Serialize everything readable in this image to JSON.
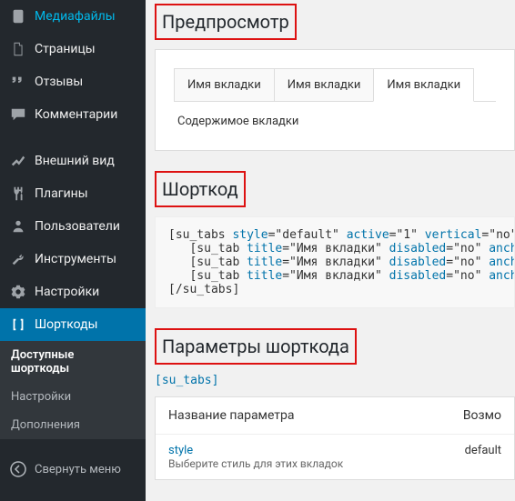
{
  "sidebar": {
    "items": [
      {
        "label": "Медиафайлы"
      },
      {
        "label": "Страницы"
      },
      {
        "label": "Отзывы"
      },
      {
        "label": "Комментарии"
      },
      {
        "label": "Внешний вид"
      },
      {
        "label": "Плагины"
      },
      {
        "label": "Пользователи"
      },
      {
        "label": "Инструменты"
      },
      {
        "label": "Настройки"
      },
      {
        "label": "Шорткоды"
      }
    ],
    "sub": [
      {
        "label": "Доступные шорткоды"
      },
      {
        "label": "Настройки"
      },
      {
        "label": "Дополнения"
      }
    ],
    "collapse": "Свернуть меню"
  },
  "sections": {
    "preview": "Предпросмотр",
    "shortcode": "Шорткод",
    "params": "Параметры шорткода"
  },
  "preview": {
    "tabs": [
      "Имя вкладки",
      "Имя вкладки",
      "Имя вкладки"
    ],
    "content": "Содержимое вкладки"
  },
  "shortcode_text": {
    "l1a": "[su_tabs ",
    "l1b": "style",
    "l1c": "=\"default\" ",
    "l1d": "active",
    "l1e": "=\"1\" ",
    "l1f": "vertical",
    "l1g": "=\"no\" cl",
    "l2a": "   [su_tab ",
    "l2b": "title",
    "l2c": "=\"Имя вкладки\" ",
    "l2d": "disabled",
    "l2e": "=\"no\" ",
    "l2f": "anchor",
    "l2g": "=",
    "l5": "[/su_tabs]"
  },
  "shortlabel": "[su_tabs]",
  "param_table": {
    "head_name": "Название параметра",
    "head_val": "Возмо",
    "row1_name": "style",
    "row1_desc": "Выберите стиль для этих вкладок",
    "row1_val": "default"
  }
}
